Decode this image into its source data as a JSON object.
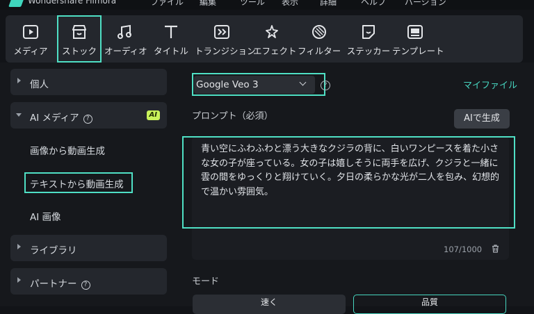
{
  "app": {
    "title": "Wondershare Filmora",
    "menu": [
      "ファイル",
      "編集",
      "ツール",
      "表示",
      "詳細",
      "ヘルプ",
      "バージョン"
    ]
  },
  "toolbar": {
    "items": [
      {
        "label": "メディア",
        "icon": "media-icon"
      },
      {
        "label": "ストック",
        "icon": "stock-icon"
      },
      {
        "label": "オーディオ",
        "icon": "audio-icon"
      },
      {
        "label": "タイトル",
        "icon": "title-icon"
      },
      {
        "label": "トランジション",
        "icon": "transition-icon"
      },
      {
        "label": "エフェクト",
        "icon": "effect-icon"
      },
      {
        "label": "フィルター",
        "icon": "filter-icon"
      },
      {
        "label": "ステッカー",
        "icon": "sticker-icon"
      },
      {
        "label": "テンプレート",
        "icon": "template-icon"
      }
    ],
    "selected": "ストック"
  },
  "sidebar": {
    "personal": "個人",
    "ai_media": "AI メディア",
    "ai_badge": "AI",
    "ai_items": [
      "画像から動画生成",
      "テキストから動画生成",
      "AI 画像"
    ],
    "library": "ライブラリ",
    "partner": "パートナー",
    "help_glyph": "?"
  },
  "main": {
    "model_value": "Google Veo 3",
    "my_file": "マイファイル",
    "prompt_label": "プロンプト（必須）",
    "ai_generate": "AIで生成",
    "prompt_text": "青い空にふわふわと漂う大きなクジラの背に、白いワンピースを着た小さな女の子が座っている。女の子は嬉しそうに両手を広げ、クジラと一緒に雲の間をゆっくりと翔けていく。夕日の柔らかな光が二人を包み、幻想的で温かい雰囲気。",
    "char_count": "107/1000",
    "mode_label": "モード",
    "mode_fast": "速く",
    "mode_quality": "品質"
  },
  "colors": {
    "accent": "#4fe0c5",
    "link": "#47d6c0",
    "badge": "#c8f25a"
  }
}
